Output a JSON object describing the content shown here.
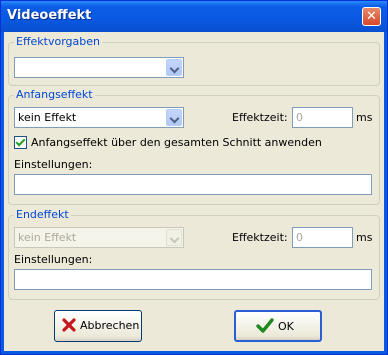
{
  "window": {
    "title": "Videoeffekt"
  },
  "effektvorgaben": {
    "legend": "Effektvorgaben",
    "selected": ""
  },
  "anfangseffekt": {
    "legend": "Anfangseffekt",
    "selected": "kein Effekt",
    "effektzeit_label": "Effektzeit:",
    "effektzeit_value": "0",
    "unit": "ms",
    "checkbox_label": "Anfangseffekt über den gesamten Schnitt anwenden",
    "checkbox_checked": true,
    "einstellungen_label": "Einstellungen:",
    "einstellungen_value": ""
  },
  "endeffekt": {
    "legend": "Endeffekt",
    "selected": "kein Effekt",
    "effektzeit_label": "Effektzeit:",
    "effektzeit_value": "0",
    "unit": "ms",
    "einstellungen_label": "Einstellungen:",
    "einstellungen_value": ""
  },
  "buttons": {
    "cancel": "Abbrechen",
    "ok": "OK"
  },
  "icons": {
    "close": "close-icon",
    "cancel": "red-x-icon",
    "ok": "green-check-icon"
  },
  "colors": {
    "titlebar": "#0a58e0",
    "legend": "#0046d5",
    "face": "#ece9d8"
  }
}
